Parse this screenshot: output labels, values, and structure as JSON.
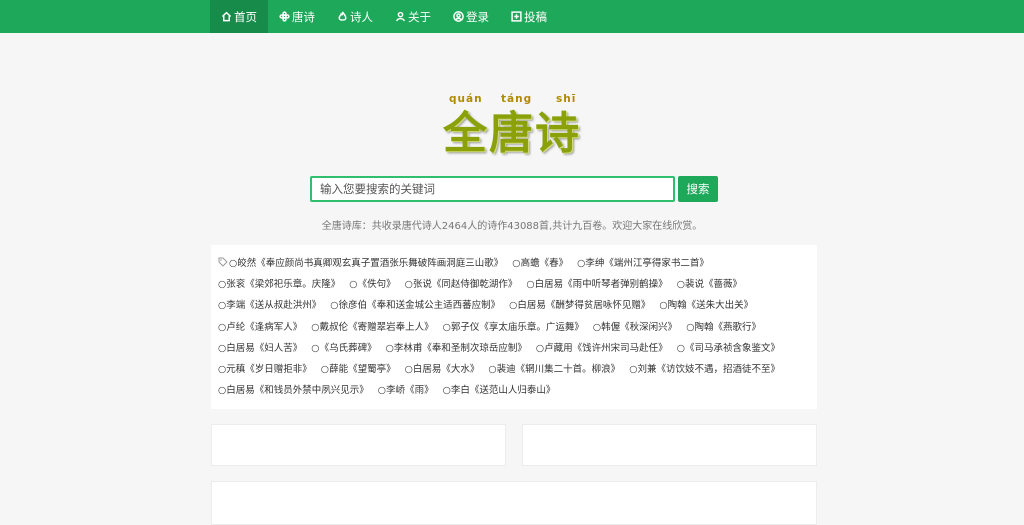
{
  "nav": {
    "items": [
      {
        "label": "首页",
        "icon": "home-icon",
        "active": true
      },
      {
        "label": "唐诗",
        "icon": "flower-icon",
        "active": false
      },
      {
        "label": "诗人",
        "icon": "flame-icon",
        "active": false
      },
      {
        "label": "关于",
        "icon": "users-icon",
        "active": false
      },
      {
        "label": "登录",
        "icon": "user-circle-icon",
        "active": false
      },
      {
        "label": "投稿",
        "icon": "plus-square-icon",
        "active": false
      }
    ]
  },
  "logo": {
    "pinyin": [
      "quán",
      "táng",
      "shī"
    ],
    "title": "全唐诗"
  },
  "search": {
    "placeholder": "输入您要搜索的关键词",
    "button_label": "搜索"
  },
  "stats": "全唐诗库：共收录唐代诗人2464人的诗作43088首,共计九百卷。欢迎大家在线欣赏。",
  "poems": [
    "○皎然《奉应颜尚书真卿观玄真子置酒张乐舞破阵画洞庭三山歌》",
    "○高蟾《春》",
    "○李绅《端州江亭得家书二首》",
    "○张衮《梁郊祀乐章。庆隆》",
    "○《佚句》",
    "○张说《同赵侍御乾湖作》",
    "○白居易《雨中听琴者弹别鹤操》",
    "○裴说《蔷薇》",
    "○李端《送从叔赴洪州》",
    "○徐彦伯《奉和送金城公主适西蕃应制》",
    "○白居易《酬梦得贫居咏怀见赠》",
    "○陶翰《送朱大出关》",
    "○卢纶《逢病军人》",
    "○戴叔伦《寄赠翠岩奉上人》",
    "○郭子仪《享太庙乐章。广运舞》",
    "○韩偓《秋深闲兴》",
    "○陶翰《燕歌行》",
    "○白居易《妇人苦》",
    "○《乌氏葬碑》",
    "○李林甫《奉和圣制次琼岳应制》",
    "○卢藏用《饯许州宋司马赴任》",
    "○《司马承祯含象鉴文》",
    "○元稹《岁日赠拒非》",
    "○薛能《望蜀亭》",
    "○白居易《大水》",
    "○裴迪《辋川集二十首。柳浪》",
    "○刘兼《访饮妓不遇，招酒徒不至》",
    "○白居易《和钱员外禁中夙兴见示》",
    "○李峤《雨》",
    "○李白《送范山人归泰山》"
  ]
}
